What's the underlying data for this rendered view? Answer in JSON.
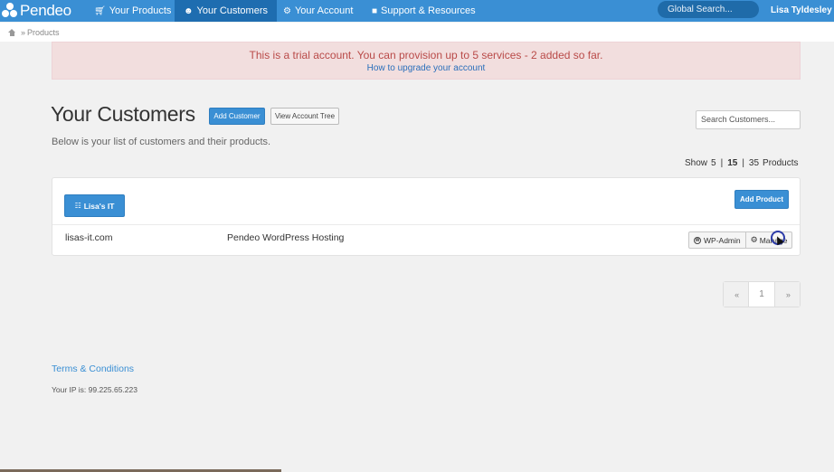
{
  "brand": {
    "name": "Pendeo"
  },
  "nav": {
    "items": [
      {
        "icon": "cart-icon",
        "label": "Your Products",
        "active": false
      },
      {
        "icon": "users-icon",
        "label": "Your Customers",
        "active": true
      },
      {
        "icon": "cogs-icon",
        "label": "Your Account",
        "active": false
      },
      {
        "icon": "folder-icon",
        "label": "Support & Resources",
        "active": false
      }
    ],
    "global_search_placeholder": "Global Search...",
    "user_name": "Lisa Tyldesley"
  },
  "breadcrumb": {
    "separator": "»",
    "current": "Products"
  },
  "alert": {
    "message": "This is a trial account. You can provision up to 5 services - 2 added so far.",
    "link": "How to upgrade your account"
  },
  "header": {
    "title": "Your Customers",
    "add_customer_label": "Add Customer",
    "view_tree_label": "View Account Tree",
    "search_placeholder": "Search Customers...",
    "subtitle": "Below is your list of customers and their products."
  },
  "show": {
    "label": "Show",
    "options": [
      "5",
      "15",
      "35"
    ],
    "selected": "15",
    "suffix": "Products"
  },
  "customer": {
    "name": "Lisa's IT",
    "add_product_label": "Add Product",
    "products": [
      {
        "domain": "lisas-it.com",
        "service": "Pendeo WordPress Hosting",
        "wp_admin_label": "WP-Admin",
        "manage_label": "Manage"
      }
    ]
  },
  "pagination": {
    "prev": "«",
    "page": "1",
    "next": "»"
  },
  "footer": {
    "terms": "Terms & Conditions",
    "ip_text": "Your IP is: 99.225.65.223"
  },
  "colors": {
    "primary": "#3a8fd4",
    "nav_active": "#1e6db0",
    "alert_bg": "#f2dede",
    "alert_text": "#b94a48"
  }
}
